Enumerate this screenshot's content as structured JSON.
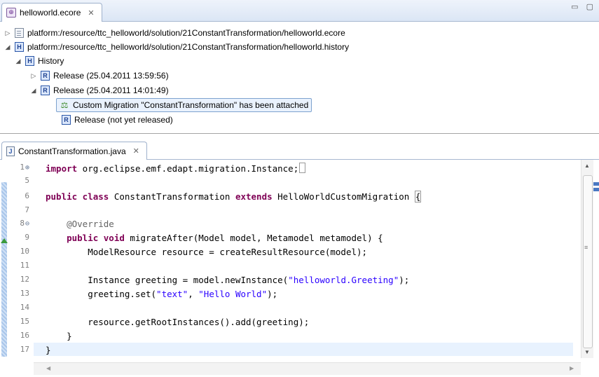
{
  "top_tab": {
    "title": "helloworld.ecore",
    "close": "✕"
  },
  "view_controls": "▭ ▢",
  "tree": [
    {
      "label": "platform:/resource/ttc_helloworld/solution/21ConstantTransformation/helloworld.ecore",
      "arrow": "▷",
      "icon": "file-icon"
    },
    {
      "label": "platform:/resource/ttc_helloworld/solution/21ConstantTransformation/helloworld.history",
      "arrow": "◢",
      "icon": "history-icon"
    },
    {
      "label": "History",
      "arrow": "◢",
      "icon": "history-icon"
    },
    {
      "label": "Release (25.04.2011 13:59:56)",
      "arrow": "▷",
      "icon": "release-icon"
    },
    {
      "label": "Release  (25.04.2011 14:01:49)",
      "arrow": "◢",
      "icon": "release-icon"
    },
    {
      "label": "Custom Migration \"ConstantTransformation\" has been attached",
      "arrow": "",
      "icon": "migration-icon"
    },
    {
      "label": "Release (not yet released)",
      "arrow": "",
      "icon": "release-icon"
    }
  ],
  "bottom_tab": {
    "title": "ConstantTransformation.java",
    "close": "✕"
  },
  "line_numbers": [
    "1",
    "5",
    "6",
    "7",
    "8",
    "9",
    "10",
    "11",
    "12",
    "13",
    "14",
    "15",
    "16",
    "17"
  ],
  "code": {
    "l1_kw": "import",
    "l1_rest": " org.eclipse.emf.edapt.migration.Instance;",
    "l6_kw1": "public class",
    "l6_name": " ConstantTransformation ",
    "l6_kw2": "extends",
    "l6_rest": " HelloWorldCustomMigration ",
    "l6_brace": "{",
    "l8_ann": "    @Override",
    "l9_kw": "    public void",
    "l9_rest": " migrateAfter(Model model, Metamodel metamodel) {",
    "l10": "        ModelResource resource = createResultResource(model);",
    "l12_a": "        Instance greeting = model.newInstance(",
    "l12_str": "\"helloworld.Greeting\"",
    "l12_b": ");",
    "l13_a": "        greeting.set(",
    "l13_str1": "\"text\"",
    "l13_mid": ", ",
    "l13_str2": "\"Hello World\"",
    "l13_b": ");",
    "l15": "        resource.getRootInstances().add(greeting);",
    "l16": "    }",
    "l17": "}"
  },
  "colors": {
    "keyword": "#7f0055",
    "string": "#2a00ff",
    "annotation": "#646464"
  }
}
